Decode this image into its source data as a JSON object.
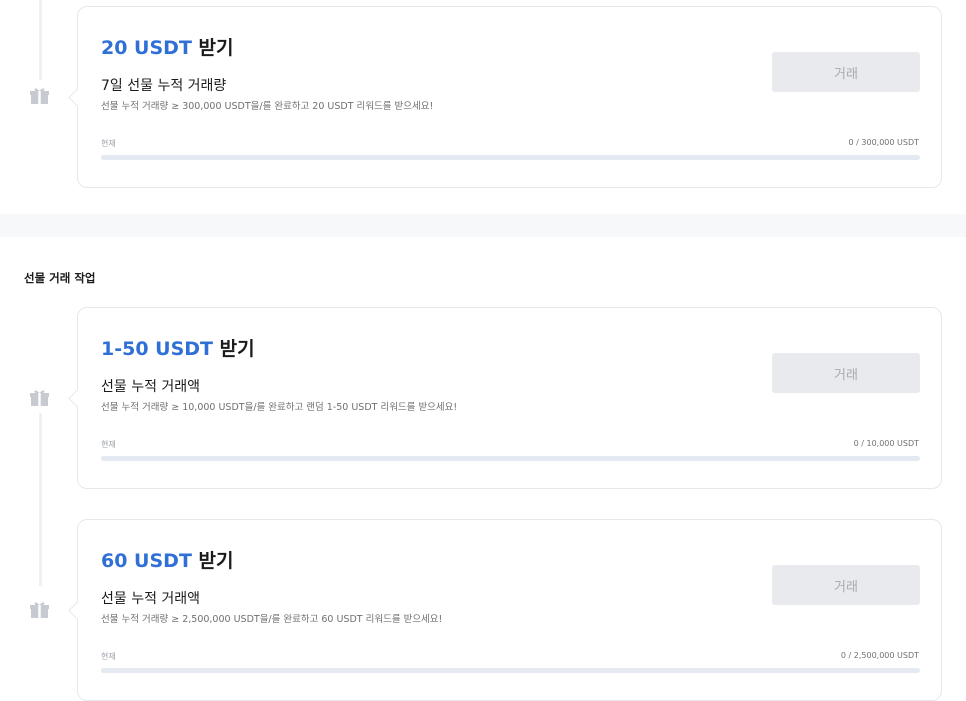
{
  "sections": {
    "futures_tasks_title": "선물 거래 작업"
  },
  "colors": {
    "accent": "#3070d6",
    "button_bg": "#e8eaed",
    "progress_track": "#e4e9f2"
  },
  "tasks": [
    {
      "reward_amount": "20 USDT",
      "reward_suffix": "받기",
      "subtitle": "7일 선물 누적 거래량",
      "description": "선물 누적 거래량 ≥ 300,000 USDT을/를 완료하고 20 USDT 리워드를 받으세요!",
      "button_label": "거래",
      "current_label": "현재",
      "progress_text": "0 / 300,000 USDT",
      "progress_fraction": 0,
      "icon": "gift-icon"
    },
    {
      "reward_amount": "1-50 USDT",
      "reward_suffix": "받기",
      "subtitle": "선물 누적 거래액",
      "description": "선물 누적 거래량 ≥ 10,000 USDT을/를 완료하고 랜덤 1-50 USDT 리워드를 받으세요!",
      "button_label": "거래",
      "current_label": "현재",
      "progress_text": "0 / 10,000 USDT",
      "progress_fraction": 0,
      "icon": "gift-icon"
    },
    {
      "reward_amount": "60 USDT",
      "reward_suffix": "받기",
      "subtitle": "선물 누적 거래액",
      "description": "선물 누적 거래량 ≥ 2,500,000 USDT을/를 완료하고 60 USDT 리워드를 받으세요!",
      "button_label": "거래",
      "current_label": "현재",
      "progress_text": "0 / 2,500,000 USDT",
      "progress_fraction": 0,
      "icon": "gift-icon"
    }
  ]
}
